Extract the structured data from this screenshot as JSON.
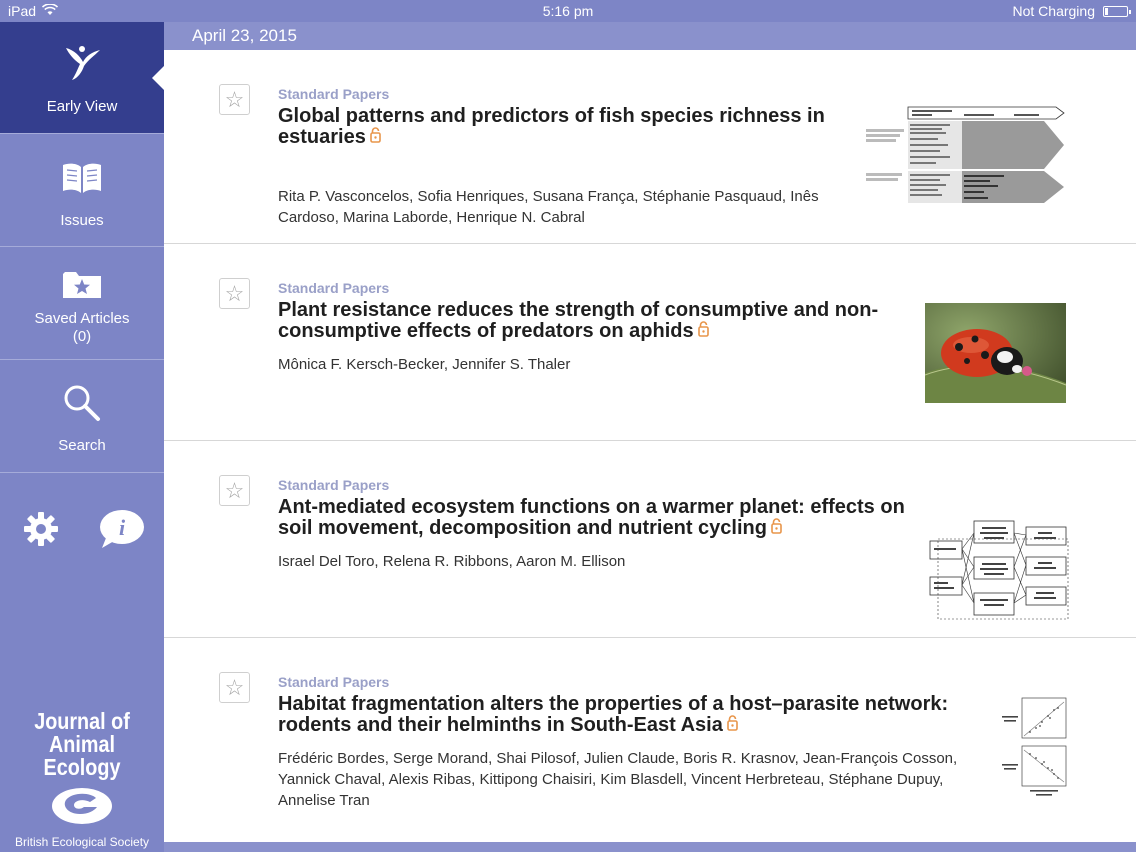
{
  "status_bar": {
    "device": "iPad",
    "time": "5:16 pm",
    "charging": "Not Charging"
  },
  "sidebar": {
    "items": [
      {
        "label": "Early View",
        "icon": "early-view-icon"
      },
      {
        "label": "Issues",
        "icon": "book-icon"
      },
      {
        "label": "Saved Articles",
        "count": "(0)",
        "icon": "folder-star-icon"
      },
      {
        "label": "Search",
        "icon": "search-icon"
      }
    ],
    "tools": {
      "settings_icon": "gear-icon",
      "info_icon": "info-icon"
    },
    "journal_logo": {
      "line1": "Journal of",
      "line2": "Animal Ecology"
    },
    "society": "British Ecological Society"
  },
  "main": {
    "date": "April 23, 2015",
    "articles": [
      {
        "section": "Standard Papers",
        "title": "Global patterns and predictors of fish species richness in estuaries",
        "authors": "Rita P. Vasconcelos, Sofia Henriques, Susana França, Stéphanie Pasquaud, Inês Cardoso, Marina Laborde, Henrique N. Cabral",
        "thumbnail": "diagram"
      },
      {
        "section": "Standard Papers",
        "title": "Plant resistance reduces the strength of consumptive and non-consumptive effects of predators on aphids",
        "authors": "Mônica F. Kersch-Becker, Jennifer S. Thaler",
        "thumbnail": "ladybug-photo"
      },
      {
        "section": "Standard Papers",
        "title": "Ant-mediated ecosystem functions on a warmer planet: effects on soil movement, decomposition and nutrient cycling",
        "authors": "Israel Del Toro, Relena R. Ribbons, Aaron M. Ellison",
        "thumbnail": "path-diagram"
      },
      {
        "section": "Standard Papers",
        "title": "Habitat fragmentation alters the properties of a host–parasite network: rodents and their helminths in South-East Asia",
        "authors": "Frédéric Bordes, Serge Morand, Shai Pilosof, Julien Claude, Boris R. Krasnov, Jean-François Cosson, Yannick Chaval, Alexis Ribas, Kittipong Chaisiri, Kim Blasdell, Vincent Herbreteau, Stéphane Dupuy, Annelise Tran",
        "thumbnail": "scatter-plots"
      }
    ]
  },
  "colors": {
    "sidebar": "#7d85c6",
    "active": "#343e8e",
    "section_label": "#9aa0c8",
    "lock": "#e8954a"
  }
}
